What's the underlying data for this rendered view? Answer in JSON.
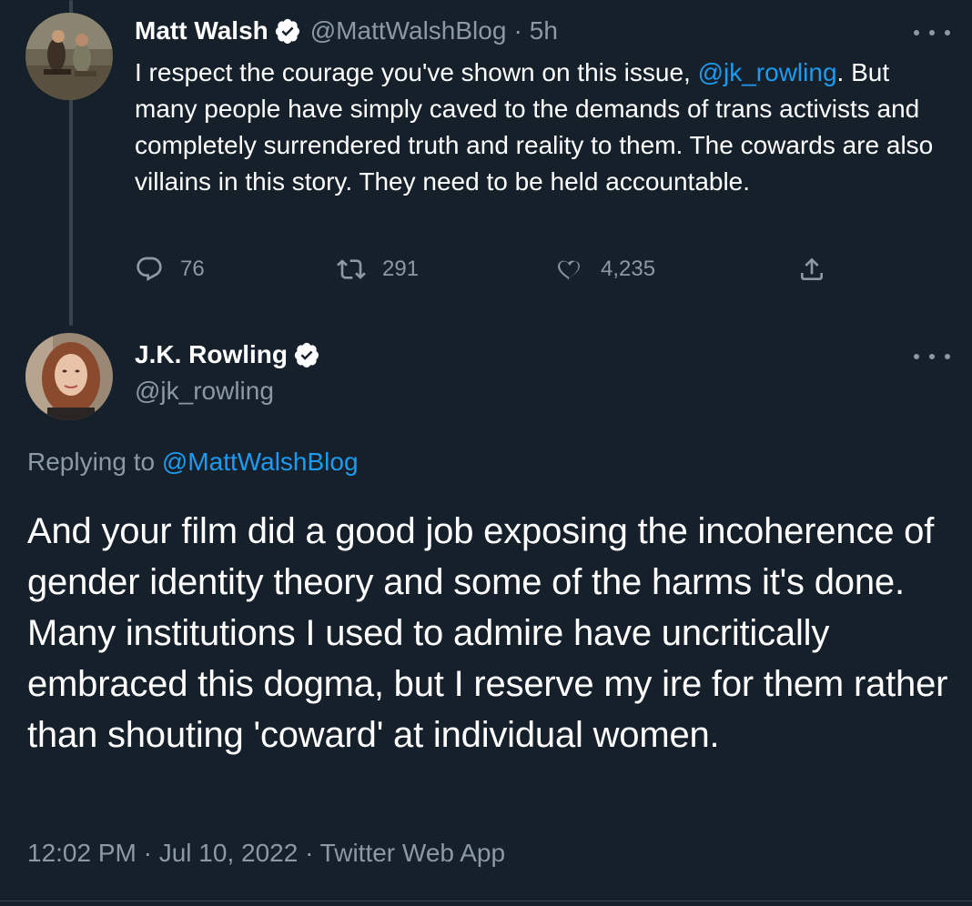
{
  "parent_tweet": {
    "author": {
      "display_name": "Matt Walsh",
      "handle": "@MattWalshBlog",
      "verified": true
    },
    "time_ago": "5h",
    "text": {
      "part1": "I respect the courage you've shown on this issue, ",
      "mention": "@jk_rowling",
      "part2": ". But many people have simply caved to the demands of trans activists and completely surrendered truth and reality to them. The cowards are also villains in this story. They need to be held accountable."
    },
    "actions": {
      "replies": "76",
      "retweets": "291",
      "likes": "4,235"
    }
  },
  "main_tweet": {
    "author": {
      "display_name": "J.K. Rowling",
      "handle": "@jk_rowling",
      "verified": true
    },
    "replying_to_label": "Replying to",
    "replying_to_handle": "@MattWalshBlog",
    "text": "And your film did a good job exposing the incoherence of gender identity theory and some of the harms it's done. Many institutions I used to admire have uncritically embraced this dogma, but I reserve my ire for them rather than shouting 'coward' at individual women.",
    "timestamp": "12:02 PM · Jul 10, 2022 · Twitter Web App"
  },
  "icons": {
    "reply": "reply-icon",
    "retweet": "retweet-icon",
    "like": "heart-icon",
    "share": "share-icon",
    "more": "more-icon",
    "verified": "verified-badge-icon"
  },
  "colors": {
    "background": "#15202b",
    "text_primary": "#ffffff",
    "text_secondary": "#8b98a5",
    "link": "#1d9bf0",
    "divider": "#38444d"
  }
}
